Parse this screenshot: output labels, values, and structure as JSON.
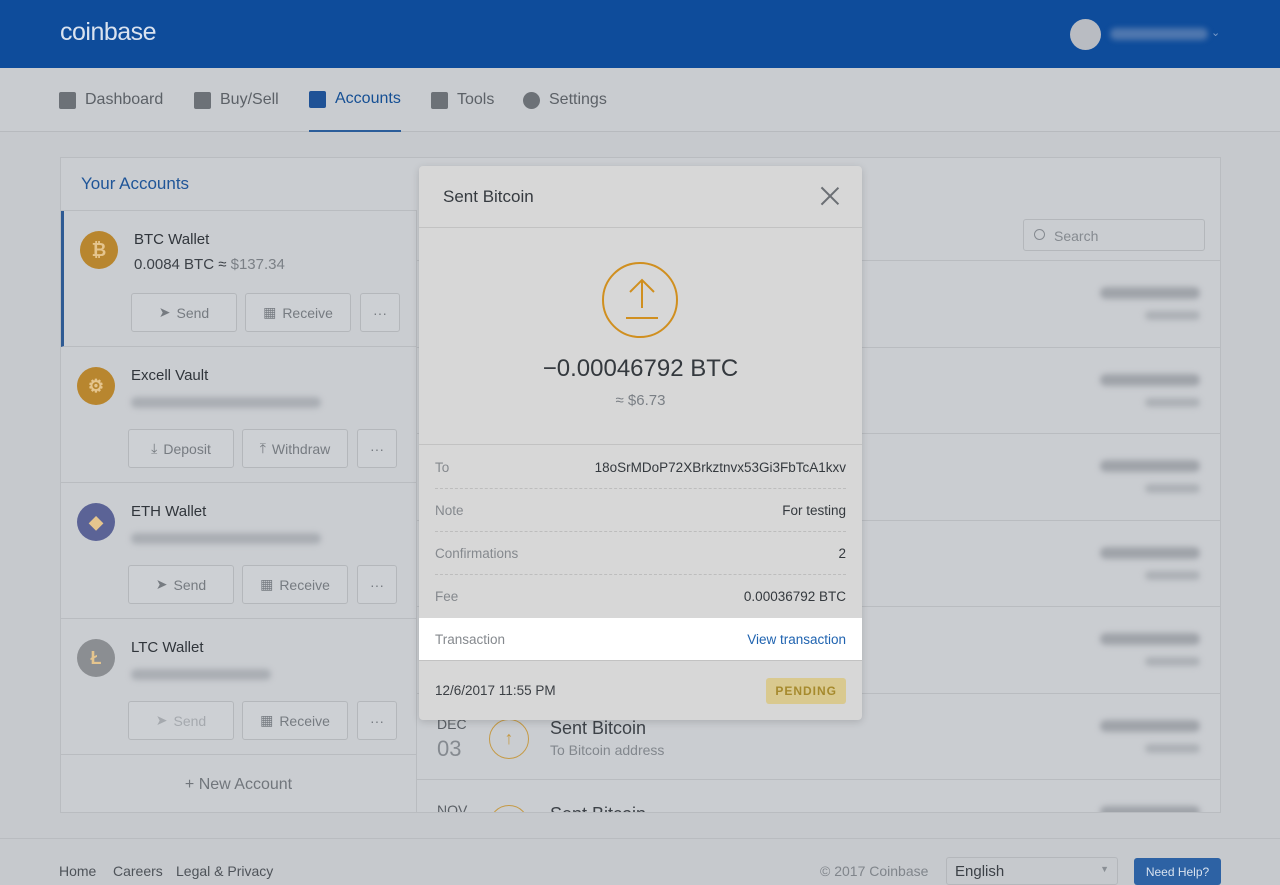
{
  "header": {
    "logo": "coinbase"
  },
  "nav": [
    {
      "label": "Dashboard",
      "icon": "dashboard-icon"
    },
    {
      "label": "Buy/Sell",
      "icon": "swap-icon"
    },
    {
      "label": "Accounts",
      "icon": "wallet-icon",
      "active": true
    },
    {
      "label": "Tools",
      "icon": "briefcase-icon"
    },
    {
      "label": "Settings",
      "icon": "gear-icon"
    }
  ],
  "accounts": {
    "title": "Your Accounts",
    "new_account": "+ New Account",
    "items": [
      {
        "name": "BTC Wallet",
        "balance": "0.0084 BTC ≈",
        "usd": "$137.34",
        "actions": [
          "Send",
          "Receive",
          "···"
        ],
        "color": "#b8862f"
      },
      {
        "name": "Excell Vault",
        "actions": [
          "Deposit",
          "Withdraw",
          "···"
        ],
        "color": "#b8862f"
      },
      {
        "name": "ETH Wallet",
        "actions": [
          "Send",
          "Receive",
          "···"
        ],
        "color": "#5b6396"
      },
      {
        "name": "LTC Wallet",
        "actions": [
          "Send",
          "Receive",
          "···"
        ],
        "color": "#8b8e92"
      }
    ]
  },
  "search": {
    "placeholder": "Search"
  },
  "transactions": [
    {
      "month": "DEC",
      "day": "03",
      "title": "Sent Bitcoin",
      "subtitle": "To Bitcoin address"
    },
    {
      "month": "NOV",
      "title": "Sent Bitcoin"
    }
  ],
  "modal": {
    "title": "Sent Bitcoin",
    "amount": "−0.00046792 BTC",
    "usd": "≈ $6.73",
    "details": [
      {
        "label": "To",
        "value": "18oSrMDoP72XBrkztnvx53Gi3FbTcA1kxv"
      },
      {
        "label": "Note",
        "value": "For testing"
      },
      {
        "label": "Confirmations",
        "value": "2"
      },
      {
        "label": "Fee",
        "value": "0.00036792 BTC"
      },
      {
        "label": "Transaction",
        "value": "View transaction",
        "link": true
      }
    ],
    "date": "12/6/2017 11:55 PM",
    "status": "PENDING",
    "accent": "#d08f1f"
  },
  "footer": {
    "links": [
      "Home",
      "Careers",
      "Legal & Privacy"
    ],
    "copyright": "© 2017 Coinbase",
    "language": "English",
    "help": "Need Help?"
  }
}
